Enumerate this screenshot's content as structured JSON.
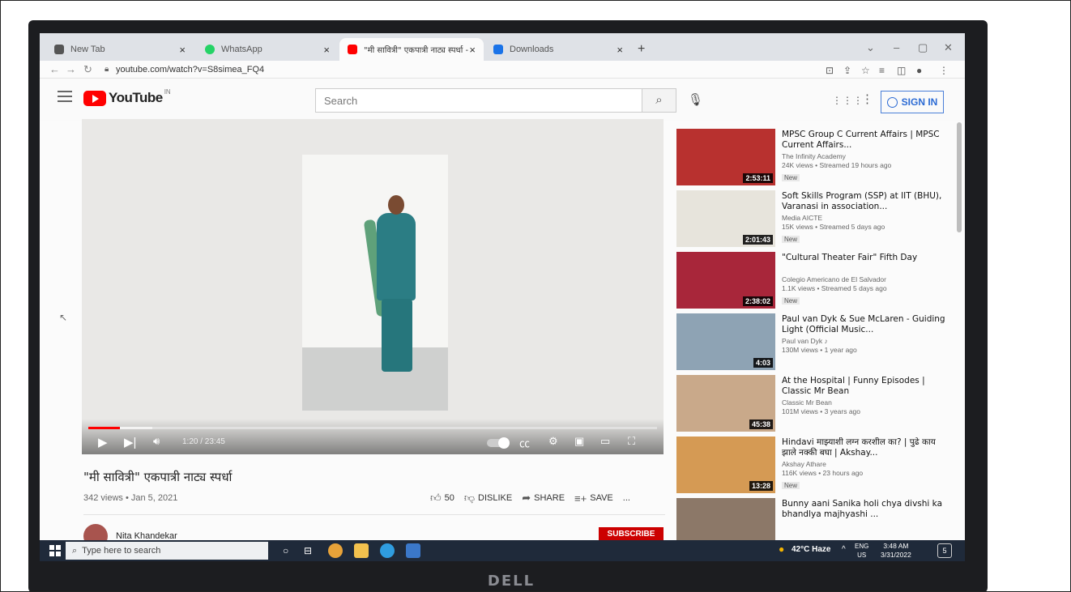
{
  "browser": {
    "tabs": [
      {
        "label": "New Tab",
        "favicon_color": "#555555",
        "active": false
      },
      {
        "label": "WhatsApp",
        "favicon_color": "#25d366",
        "active": false
      },
      {
        "label": "\"मी सावित्री\" एकपात्री नाट्य स्पर्धा - Yo",
        "favicon_color": "#ff0000",
        "active": true
      },
      {
        "label": "Downloads",
        "favicon_color": "#1a73e8",
        "active": false
      }
    ],
    "url": "youtube.com/watch?v=S8simea_FQ4"
  },
  "youtube": {
    "logo_text": "YouTube",
    "region": "IN",
    "search_placeholder": "Search",
    "sign_in": "SIGN IN",
    "brand_color": "#ff0000",
    "link_color": "#2c6bd4"
  },
  "player": {
    "time": "1:20 / 23:45",
    "progress_fraction": 0.056
  },
  "video": {
    "title": "\"मी सावित्री\" एकपात्री नाट्य स्पर्धा",
    "meta": "342 views • Jan 5, 2021",
    "likes": "50",
    "dislike": "DISLIKE",
    "share": "SHARE",
    "save": "SAVE",
    "more": "...",
    "channel": "Nita Khandekar",
    "subscribe": "SUBSCRIBE"
  },
  "recommendations": [
    {
      "title": "MPSC Group C Current Affairs | MPSC Current Affairs...",
      "channel": "The Infinity Academy",
      "views": "24K views • Streamed 19 hours ago",
      "badge": "New",
      "duration": "2:53:11",
      "thumb_color": "#b8312f"
    },
    {
      "title": "Soft Skills Program (SSP) at IIT (BHU), Varanasi in association...",
      "channel": "Media AICTE",
      "views": "15K views • Streamed 5 days ago",
      "badge": "New",
      "duration": "2:01:43",
      "thumb_color": "#e7e4dc"
    },
    {
      "title": "\"Cultural Theater Fair\" Fifth Day",
      "channel": "Colegio Americano de El Salvador",
      "views": "1.1K views • Streamed 5 days ago",
      "badge": "New",
      "duration": "2:38:02",
      "thumb_color": "#a8263a"
    },
    {
      "title": "Paul van Dyk & Sue McLaren - Guiding Light (Official Music...",
      "channel": "Paul van Dyk ♪",
      "views": "130M views • 1 year ago",
      "badge": "",
      "duration": "4:03",
      "thumb_color": "#8ea3b4"
    },
    {
      "title": "At the Hospital | Funny Episodes | Classic Mr Bean",
      "channel": "Classic Mr Bean",
      "views": "101M views • 3 years ago",
      "badge": "",
      "duration": "45:38",
      "thumb_color": "#c9a98a"
    },
    {
      "title": "Hindavi माझ्याशी लग्न करशील का? | पुढे काय झाले नक्की बघा | Akshay...",
      "channel": "Akshay Athare",
      "views": "116K views • 23 hours ago",
      "badge": "New",
      "duration": "13:28",
      "thumb_color": "#d59a54"
    },
    {
      "title": "Bunny aani Sanika holi chya divshi ka bhandlya majhyashi ...",
      "channel": "",
      "views": "",
      "badge": "",
      "duration": "",
      "thumb_color": "#8c7868"
    }
  ],
  "taskbar": {
    "search_placeholder": "Type here to search",
    "weather": "42°C  Haze",
    "lang_top": "ENG",
    "lang_bottom": "US",
    "time": "3:48 AM",
    "date": "3/31/2022",
    "notifications": "5"
  },
  "bezel": {
    "brand": "DELL"
  }
}
